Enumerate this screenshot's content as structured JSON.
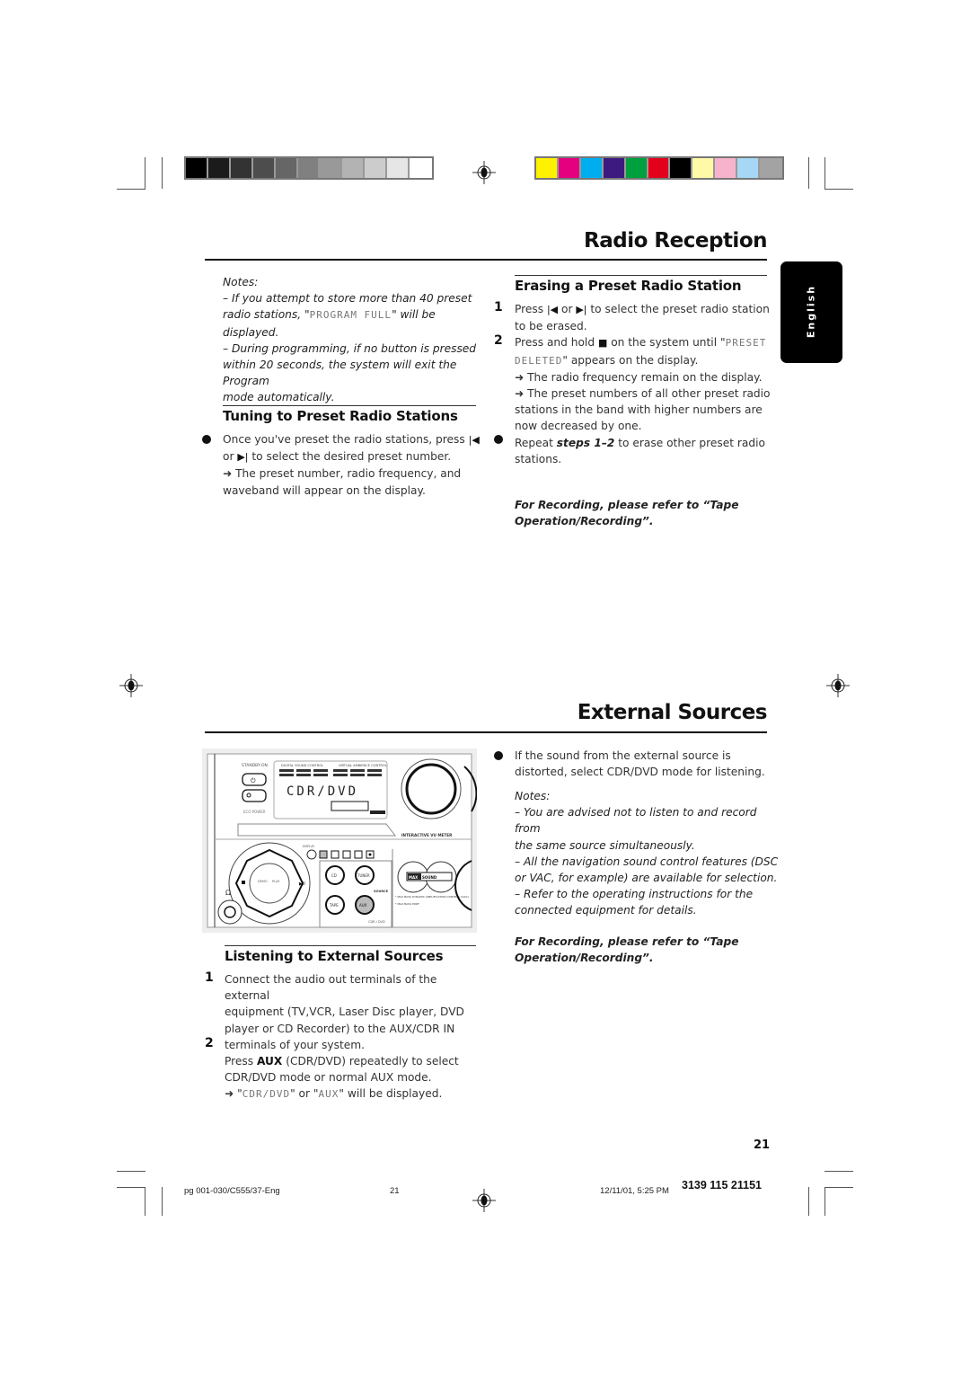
{
  "color_bars": {
    "grayscale": [
      "#000000",
      "#1b1b1b",
      "#333333",
      "#4d4d4d",
      "#666666",
      "#808080",
      "#999999",
      "#b3b3b3",
      "#cccccc",
      "#e6e6e6",
      "#ffffff"
    ],
    "process": [
      "#fff200",
      "#e4007f",
      "#00aeef",
      "#3d1a7f",
      "#00a03e",
      "#e2001a",
      "#000000",
      "#fff9a8",
      "#f7b3cc",
      "#a6d8f5",
      "#a3a3a3"
    ]
  },
  "radio_reception": {
    "title": "Radio Reception",
    "notes": {
      "heading": "Notes:",
      "note1_a": "–  If you attempt to store more than 40 preset",
      "note1_b_pre": "radio stations, \"",
      "note1_b_lcd": "PROGRAM FULL",
      "note1_b_post": "\" will be",
      "note1_c": "displayed.",
      "note2_a": "–  During programming, if no button is pressed",
      "note2_b": "within 20 seconds, the system will exit the Program",
      "note2_c": "mode automatically."
    },
    "tuning": {
      "heading": "Tuning to Preset Radio Stations",
      "line1": "Once you've preset the radio stations, press",
      "line2_pre": "or",
      "line2_post": "to select the desired preset number.",
      "line3": "➜ The preset number, radio frequency, and",
      "line4": "waveband will appear on the display."
    },
    "erasing": {
      "heading": "Erasing a Preset Radio Station",
      "step1_num": "1",
      "step1_a_pre": "Press",
      "step1_a_mid": "or",
      "step1_a_post": "to select the preset radio station",
      "step1_b": "to be erased.",
      "step2_num": "2",
      "step2_a_pre": "Press and hold",
      "step2_a_post": "on the system until \"",
      "step2_a_lcd": "PRESET",
      "step2_b_lcd": "DELETED",
      "step2_b_post": "\" appears on the display.",
      "result1": "➜ The radio frequency remain on the display.",
      "result2_a": "➜ The preset numbers of all other preset radio",
      "result2_b": "stations in the band with higher numbers are",
      "result2_c": "now decreased by one.",
      "repeat_pre": "Repeat",
      "repeat_bold": "steps 1–2",
      "repeat_post": "to erase other preset radio",
      "repeat_b": "stations."
    },
    "recording_ref_a": "For Recording, please refer to “Tape",
    "recording_ref_b": "Operation/Recording”."
  },
  "language_tab": "English",
  "external_sources": {
    "title": "External Sources",
    "device": {
      "standby_label": "STANDBY-ON",
      "eco_label": "ECO POWER",
      "dsc_label": "DIGITAL SOUND CONTROL",
      "vac_label": "VIRTUAL AMBIENCE CONTROL",
      "display_text": "CDR/DVD",
      "vu_label": "INTERACTIVE VU METER",
      "display_btn": "DISPLAY",
      "prog": "PROG",
      "cd": "CD",
      "tuner": "TUNER",
      "tape": "TAPE",
      "aux": "AUX",
      "source": "SOURCE",
      "maxsound": "MAXSOUND",
      "mbdac": "* MAX BASS DYNAMIC AMPLIFICATION CONTROL (DAC)",
      "mbport": "* MAX BASS PORT",
      "cdr_dvd": "CDR / DVD",
      "demo": "DEMO STOP CLEAR",
      "play": "PLAY PAUSE"
    },
    "listening": {
      "heading": "Listening to External Sources",
      "step1_num": "1",
      "step1_a": "Connect the audio out terminals of the external",
      "step1_b": "equipment (TV,VCR, Laser Disc player, DVD",
      "step1_c": "player or CD Recorder) to the AUX/CDR IN",
      "step1_d": "terminals of your system.",
      "step2_num": "2",
      "step2_a_pre": "Press",
      "step2_a_bold": "AUX",
      "step2_a_post": "(CDR/DVD) repeatedly to select",
      "step2_b": "CDR/DVD mode or normal AUX mode.",
      "step2_c_pre": "➜ \"",
      "step2_c_lcd1": "CDR/DVD",
      "step2_c_mid": "\" or \"",
      "step2_c_lcd2": "AUX",
      "step2_c_post": "\" will be displayed."
    },
    "right": {
      "bullet_a": "If the sound from the external source is",
      "bullet_b": "distorted, select CDR/DVD mode for listening.",
      "notes_heading": "Notes:",
      "n1_a": "–  You are advised not to listen to and record from",
      "n1_b": "the same source simultaneously.",
      "n2_a": "–  All the navigation sound control features (DSC",
      "n2_b": "or VAC, for example) are available for selection.",
      "n3_a": "–  Refer to the operating instructions for the",
      "n3_b": "connected equipment for details.",
      "recording_ref_a": "For Recording, please refer to “Tape",
      "recording_ref_b": "Operation/Recording”."
    }
  },
  "page_number": "21",
  "footer": {
    "file": "pg 001-030/C555/37-Eng",
    "page": "21",
    "date": "12/11/01, 5:25 PM",
    "code": "3139 115 21151"
  }
}
